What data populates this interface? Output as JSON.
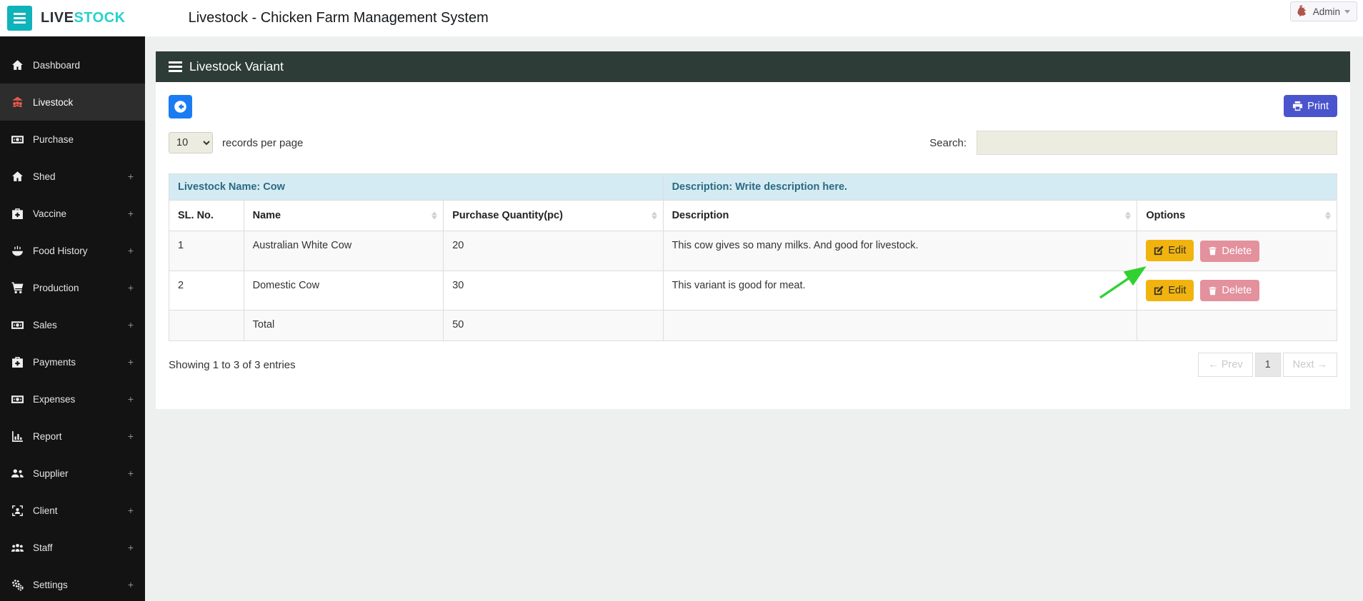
{
  "brand": {
    "live": "LIVE",
    "stock": "STOCK"
  },
  "header": {
    "title": "Livestock - Chicken Farm Management System",
    "user": "Admin"
  },
  "sidebar": {
    "plus_glyph": "+",
    "items": [
      {
        "label": "Dashboard",
        "icon": "home-icon",
        "active": false,
        "expandable": false
      },
      {
        "label": "Livestock",
        "icon": "livestock-icon",
        "active": true,
        "expandable": false
      },
      {
        "label": "Purchase",
        "icon": "banknote-icon",
        "active": false,
        "expandable": false
      },
      {
        "label": "Shed",
        "icon": "home-icon",
        "active": false,
        "expandable": true
      },
      {
        "label": "Vaccine",
        "icon": "medkit-icon",
        "active": false,
        "expandable": true
      },
      {
        "label": "Food History",
        "icon": "food-bowl-icon",
        "active": false,
        "expandable": true
      },
      {
        "label": "Production",
        "icon": "cart-icon",
        "active": false,
        "expandable": true
      },
      {
        "label": "Sales",
        "icon": "banknote-icon",
        "active": false,
        "expandable": true
      },
      {
        "label": "Payments",
        "icon": "medkit-icon",
        "active": false,
        "expandable": true
      },
      {
        "label": "Expenses",
        "icon": "banknote-icon",
        "active": false,
        "expandable": true
      },
      {
        "label": "Report",
        "icon": "bar-chart-icon",
        "active": false,
        "expandable": true
      },
      {
        "label": "Supplier",
        "icon": "users-icon",
        "active": false,
        "expandable": true
      },
      {
        "label": "Client",
        "icon": "users-frame-icon",
        "active": false,
        "expandable": true
      },
      {
        "label": "Staff",
        "icon": "users-group-icon",
        "active": false,
        "expandable": true
      },
      {
        "label": "Settings",
        "icon": "gears-icon",
        "active": false,
        "expandable": true
      }
    ]
  },
  "panel": {
    "title": "Livestock Variant"
  },
  "toolbar": {
    "print_label": "Print"
  },
  "controls": {
    "records_value": "10",
    "records_label": "records per page",
    "search_label": "Search:",
    "search_value": ""
  },
  "table": {
    "group_headers": {
      "left": "Livestock Name: Cow",
      "right": "Description: Write description here."
    },
    "columns": {
      "sl": "SL. No.",
      "name": "Name",
      "qty": "Purchase Quantity(pc)",
      "desc": "Description",
      "options": "Options"
    },
    "rows": [
      {
        "sl": "1",
        "name": "Australian White Cow",
        "qty": "20",
        "desc": "This cow gives so many milks. And good for livestock."
      },
      {
        "sl": "2",
        "name": "Domestic Cow",
        "qty": "30",
        "desc": "This variant is good for meat."
      }
    ],
    "total_row": {
      "label": "Total",
      "qty": "50"
    },
    "edit_label": "Edit",
    "delete_label": "Delete"
  },
  "footer": {
    "showing": "Showing 1 to 3 of 3 entries",
    "prev_label": "← Prev",
    "page": "1",
    "next_label": "Next →"
  },
  "colors": {
    "brand_teal": "#0fb3ba",
    "brand_text_teal": "#25d2cc",
    "sidebar_bg": "#131313",
    "active_icon": "#e4594d",
    "panel_header": "#2d3c36",
    "back_button_blue": "#1a7cf2",
    "print_button_indigo": "#4a54cc",
    "group_header_bg": "#d5ebf3",
    "group_header_text": "#2b6a80",
    "edit_yellow": "#f1b30e",
    "delete_pink": "#e2919d",
    "annotation_green": "#30d130"
  }
}
